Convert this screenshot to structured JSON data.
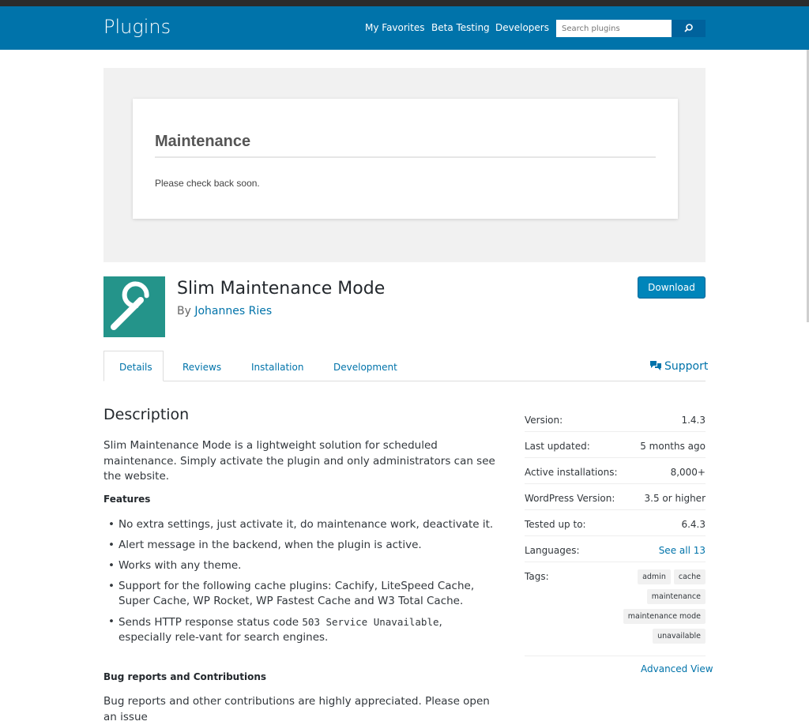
{
  "header": {
    "brand": "Plugins",
    "nav": [
      "My Favorites",
      "Beta Testing",
      "Developers"
    ],
    "search_placeholder": "Search plugins",
    "search_icon": "search-icon"
  },
  "banner": {
    "title": "Maintenance",
    "text": "Please check back soon."
  },
  "plugin": {
    "icon": "wrench-icon",
    "title": "Slim Maintenance Mode",
    "by": "By",
    "author": "Johannes Ries",
    "download_label": "Download"
  },
  "tabs": {
    "items": [
      "Details",
      "Reviews",
      "Installation",
      "Development"
    ],
    "active": "Details",
    "support_label": "Support",
    "support_icon": "chat-bubbles-icon"
  },
  "description": {
    "heading": "Description",
    "intro": "Slim Maintenance Mode is a lightweight solution for scheduled maintenance. Simply activate the plugin and only administrators can see the website.",
    "features_heading": "Features",
    "features": [
      "No extra settings, just activate it, do maintenance work, deactivate it.",
      "Alert message in the backend, when the plugin is active.",
      "Works with any theme.",
      "Support for the following cache plugins: Cachify, LiteSpeed Cache, Super Cache, WP Rocket, WP Fastest Cache and W3 Total Cache."
    ],
    "feature5_prefix": "Sends HTTP response status code",
    "feature5_code": "503 Service Unavailable",
    "feature5_suffix": ", especially rele-vant for search engines.",
    "bugs_heading": "Bug reports and Contributions",
    "bugs_text": "Bug reports and other contributions are highly appreciated. Please open an issue"
  },
  "meta": {
    "rows": [
      {
        "label": "Version:",
        "value": "1.4.3"
      },
      {
        "label": "Last updated:",
        "value": "5 months ago"
      },
      {
        "label": "Active installations:",
        "value": "8,000+"
      },
      {
        "label": "WordPress Version:",
        "value": "3.5 or higher"
      },
      {
        "label": "Tested up to:",
        "value": "6.4.3"
      },
      {
        "label": "Languages:",
        "value": "See all 13"
      }
    ],
    "tags_label": "Tags:",
    "tags": [
      "admin",
      "cache",
      "maintenance",
      "maintenance mode",
      "unavailable"
    ],
    "advanced_view": "Advanced View"
  },
  "colors": {
    "header_bg": "#0073aa",
    "link": "#0073aa",
    "icon_bg": "#24948a",
    "download_bg": "#0085ba"
  }
}
